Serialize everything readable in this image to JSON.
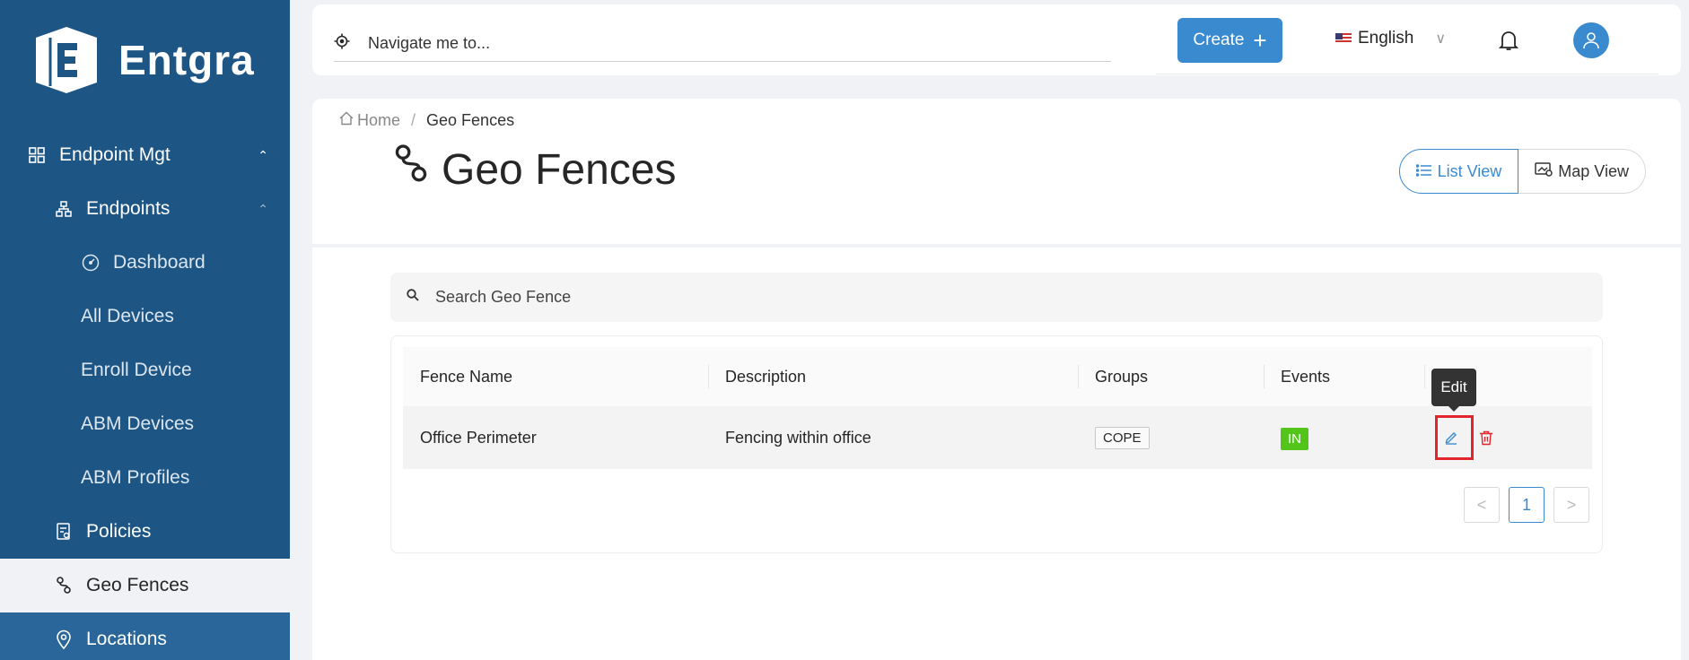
{
  "brand": {
    "name": "Entgra"
  },
  "sidebar": {
    "items": [
      {
        "label": "Endpoint Mgt",
        "icon": "grid-icon",
        "level": 0,
        "expanded": true
      },
      {
        "label": "Endpoints",
        "icon": "hierarchy-icon",
        "level": 1,
        "expanded": true
      },
      {
        "label": "Dashboard",
        "icon": "dashboard-gauge-icon",
        "level": 2
      },
      {
        "label": "All Devices",
        "level": 2
      },
      {
        "label": "Enroll Device",
        "level": 2
      },
      {
        "label": "ABM Devices",
        "level": 2
      },
      {
        "label": "ABM Profiles",
        "level": 2
      },
      {
        "label": "Policies",
        "icon": "policy-document-icon",
        "level": 1
      },
      {
        "label": "Geo Fences",
        "icon": "geo-fence-icon",
        "level": 1,
        "active": true
      },
      {
        "label": "Locations",
        "icon": "location-pin-icon",
        "level": 1
      }
    ]
  },
  "header": {
    "nav_search_placeholder": "Navigate me to...",
    "create_label": "Create",
    "language": "English"
  },
  "breadcrumb": {
    "home": "Home",
    "current": "Geo Fences"
  },
  "page": {
    "title": "Geo Fences",
    "list_view_label": "List View",
    "map_view_label": "Map View",
    "active_view": "List View"
  },
  "search": {
    "placeholder": "Search Geo Fence"
  },
  "table": {
    "columns": [
      "Fence Name",
      "Description",
      "Groups",
      "Events"
    ],
    "rows": [
      {
        "fence_name": "Office Perimeter",
        "description": "Fencing within office",
        "groups": "COPE",
        "events": "IN"
      }
    ]
  },
  "tooltip": {
    "edit": "Edit"
  },
  "pagination": {
    "current_page": "1",
    "prev": "<",
    "next": ">"
  },
  "colors": {
    "sidebar_bg": "#1d5585",
    "accent": "#3a8ad0",
    "success": "#52c41a",
    "danger": "#e3242b"
  }
}
